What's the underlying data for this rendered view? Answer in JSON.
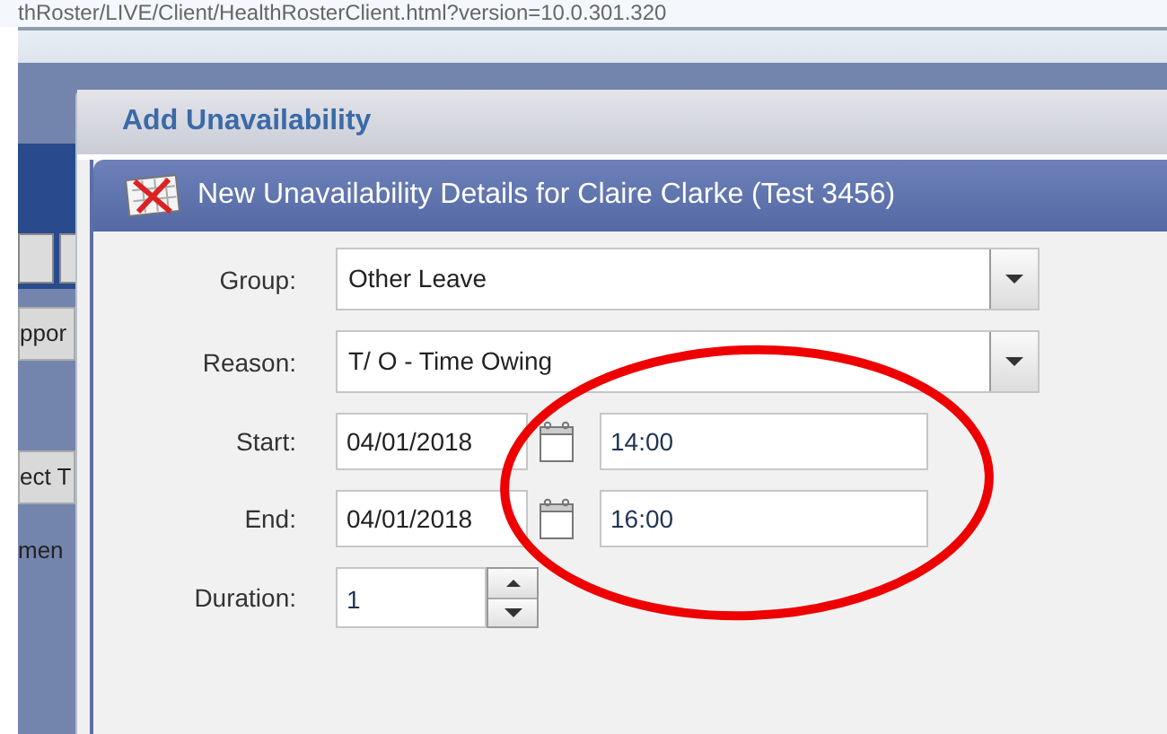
{
  "address_bar": {
    "url": "thRoster/LIVE/Client/HealthRosterClient.html?version=10.0.301.320"
  },
  "background": {
    "fragments": [
      "ppor",
      "ect T",
      "men"
    ]
  },
  "dialog": {
    "title": "Add Unavailability",
    "panel_title": "New Unavailability Details for Claire Clarke (Test 3456)",
    "fields": [
      {
        "kind": "combo",
        "label": "Group:",
        "value": "Other Leave"
      },
      {
        "kind": "combo",
        "label": "Reason:",
        "value": "T/ O - Time Owing"
      },
      {
        "kind": "datetime",
        "label": "Start:",
        "date": "04/01/2018",
        "time": "14:00"
      },
      {
        "kind": "datetime",
        "label": "End:",
        "date": "04/01/2018",
        "time": "16:00"
      },
      {
        "kind": "spinner",
        "label": "Duration:",
        "value": "1"
      }
    ]
  },
  "annotation": {
    "kind": "ellipse"
  }
}
